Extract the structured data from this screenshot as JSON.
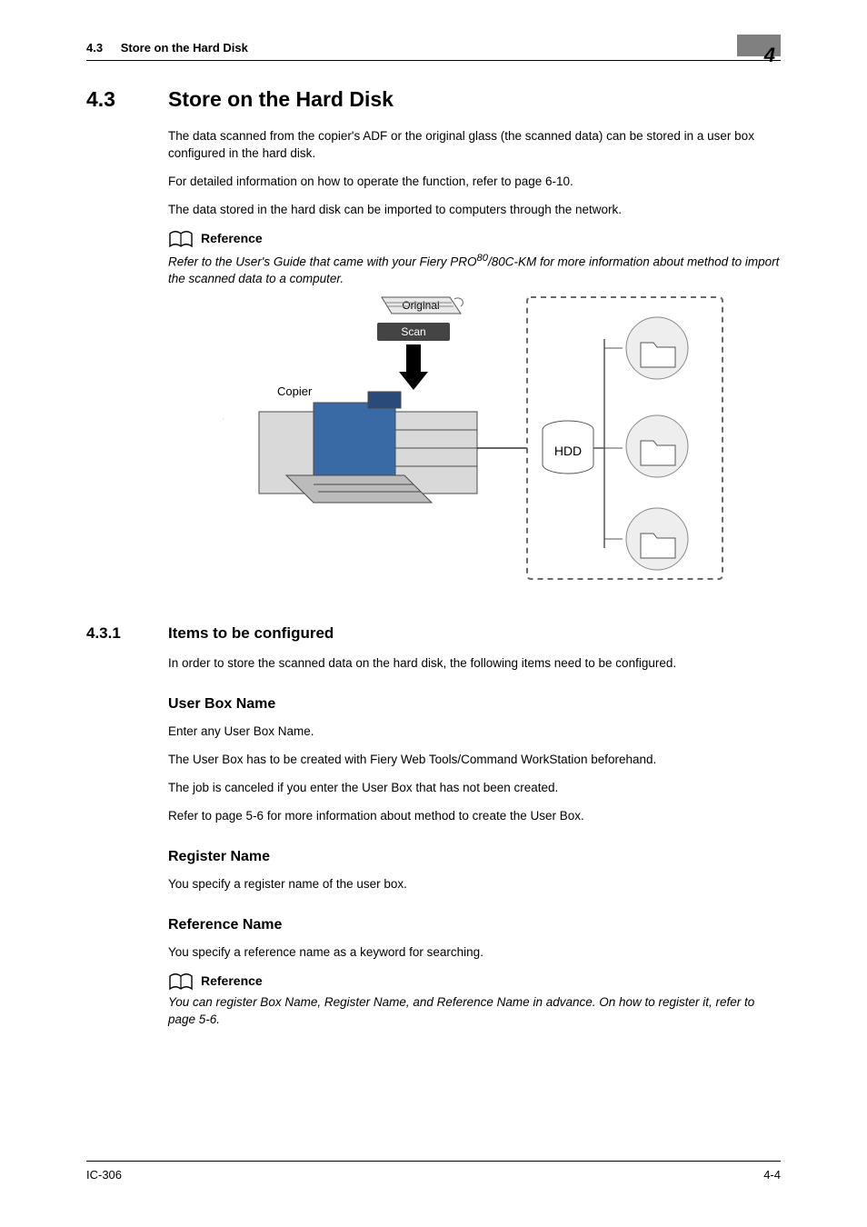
{
  "running_header": {
    "section_number": "4.3",
    "section_title": "Store on the Hard Disk",
    "chapter_number": "4"
  },
  "section": {
    "number": "4.3",
    "title": "Store on the Hard Disk",
    "para1": "The data scanned from the copier's ADF or the original glass (the scanned data) can be stored in a user box configured in the hard disk.",
    "para2": "For detailed information on how to operate the function, refer to page 6-10.",
    "para3": "The data stored in the hard disk can be imported to computers through the network.",
    "reference_label": "Reference",
    "reference_text_pre": "Refer to the User's Guide that came with your Fiery PRO",
    "reference_text_sup": "80",
    "reference_text_post": "/80C-KM for more information about method to import the scanned data to a computer."
  },
  "diagram": {
    "label_original": "Original",
    "label_scan": "Scan",
    "label_copier": "Copier",
    "label_hdd": "HDD"
  },
  "subsection": {
    "number": "4.3.1",
    "title": "Items to be configured",
    "intro": "In order to store the scanned data on the hard disk, the following items need to be configured.",
    "user_box_name": {
      "heading": "User Box Name",
      "p1": "Enter any User Box Name.",
      "p2": "The User Box has to be created with Fiery Web Tools/Command WorkStation beforehand.",
      "p3": "The job is canceled if you enter the User Box that has not been created.",
      "p4": "Refer to page 5-6 for more information about method to create the User Box."
    },
    "register_name": {
      "heading": "Register Name",
      "p1": "You specify a register name of the user box."
    },
    "reference_name": {
      "heading": "Reference Name",
      "p1": "You specify a reference name as a keyword for searching."
    },
    "reference2_label": "Reference",
    "reference2_text": "You can register Box Name, Register Name, and Reference Name in advance. On how to register it, refer to page 5-6."
  },
  "footer": {
    "left": "IC-306",
    "right": "4-4"
  }
}
